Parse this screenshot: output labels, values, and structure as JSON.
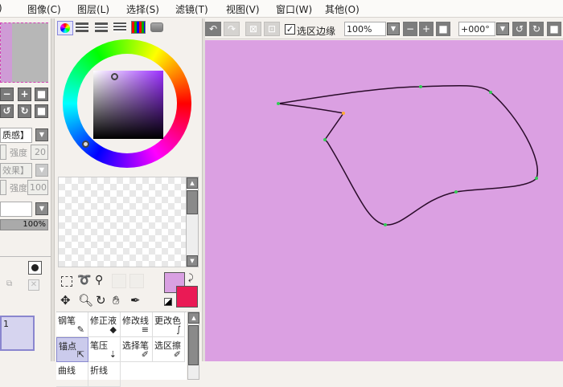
{
  "menu": {
    "items": [
      "图像(C)",
      "图层(L)",
      "选择(S)",
      "滤镜(T)",
      "视图(V)",
      "窗口(W)",
      "其他(O)"
    ],
    "cut_prefix": ")"
  },
  "left_panel": {
    "texture_label": "质感】",
    "strength_label_1": "强度",
    "strength_value_1": "20",
    "effect_label": "效果】",
    "strength_label_2": "强度",
    "strength_value_2": "100",
    "opacity_value": "100%",
    "layer_name": "1",
    "colors": {
      "swatch": "#b7b7b7",
      "layer_select": "#d6d4ef"
    }
  },
  "color_panel": {
    "hue_color": "#9b30ff",
    "primary_color": "#d9a0e2",
    "secondary_color": "#ea1a55"
  },
  "toolbar": {
    "selection_edge_label": "选区边缘",
    "selection_edge_checked": true,
    "zoom_value": "100%",
    "rotation_value": "+000°"
  },
  "tools": {
    "row1": [
      "钢笔",
      "修正液",
      "修改线",
      "更改色"
    ],
    "row2": [
      "锚点",
      "笔压",
      "选择笔",
      "选区擦"
    ],
    "row3": [
      "曲线",
      "折线"
    ]
  },
  "canvas": {
    "background": "#dba0e2"
  }
}
